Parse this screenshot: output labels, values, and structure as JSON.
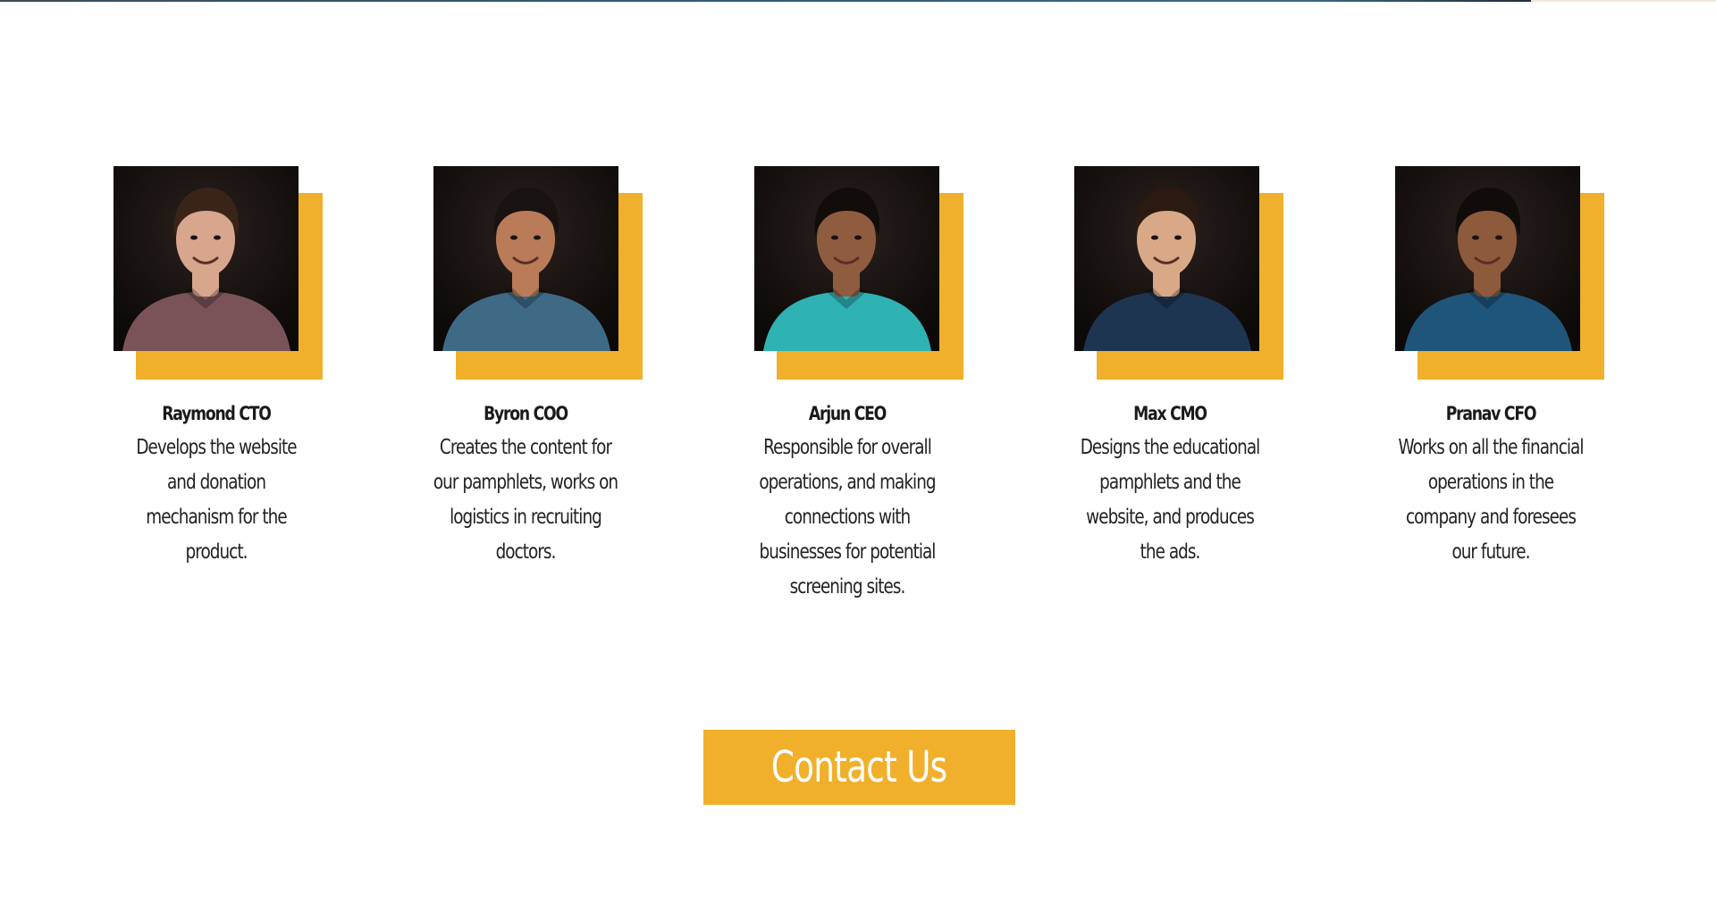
{
  "colors": {
    "accent": "#f0b02c",
    "text": "#1a1a1a",
    "background": "#ffffff"
  },
  "team": {
    "members": [
      {
        "name": "Raymond CTO",
        "description": "Develops the website and donation mechanism for the product.",
        "photo_shirt_color": "#7a5358",
        "photo_skin_color": "#d8a58d",
        "photo_hair_color": "#3a2418"
      },
      {
        "name": "Byron COO",
        "description": "Creates the content for our pamphlets, works on logistics in recruiting doctors.",
        "photo_shirt_color": "#3f6a86",
        "photo_skin_color": "#b97b58",
        "photo_hair_color": "#181212"
      },
      {
        "name": "Arjun CEO",
        "description": "Responsible for overall operations, and making connections with businesses for potential screening sites.",
        "photo_shirt_color": "#2fb2b4",
        "photo_skin_color": "#8f5c40",
        "photo_hair_color": "#120c0a"
      },
      {
        "name": "Max CMO",
        "description": "Designs the educational pamphlets and the website, and produces the ads.",
        "photo_shirt_color": "#1e3552",
        "photo_skin_color": "#d9a987",
        "photo_hair_color": "#2a1a12"
      },
      {
        "name": "Pranav CFO",
        "description": "Works on all the financial operations in the company and foresees our future.",
        "photo_shirt_color": "#1f557a",
        "photo_skin_color": "#8e5a3c",
        "photo_hair_color": "#100c0a"
      }
    ]
  },
  "contact": {
    "label": "Contact Us"
  }
}
